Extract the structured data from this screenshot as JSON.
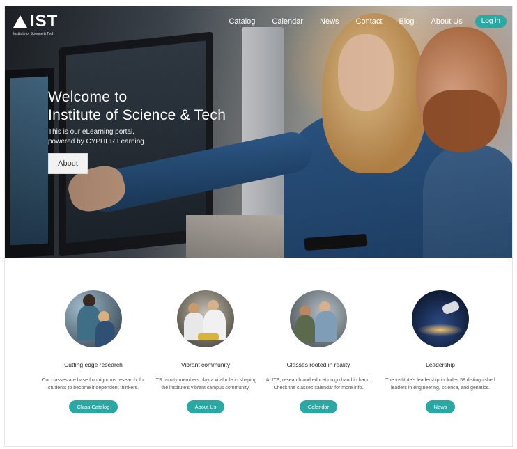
{
  "brand": {
    "logo": "IST",
    "tagline": "Institute of Science & Tech"
  },
  "nav": {
    "items": [
      "Catalog",
      "Calendar",
      "News",
      "Contact",
      "Blog",
      "About Us"
    ],
    "login": "Log in"
  },
  "hero": {
    "title_line1": "Welcome to",
    "title_line2": "Institute of Science & Tech",
    "subtitle_line1": "This is our eLearning portal,",
    "subtitle_line2": "powered by CYPHER Learning",
    "button": "About"
  },
  "features": [
    {
      "title": "Cutting edge research",
      "description": "Our classes are based on rigorous research, for students to become independent thinkers.",
      "button": "Class Catalog",
      "image": "research-photo"
    },
    {
      "title": "Vibrant community",
      "description": "ITS faculty members play a vital role in shaping the institute's vibrant campus community.",
      "button": "About Us",
      "image": "community-photo"
    },
    {
      "title": "Classes rooted in reality",
      "description": "At ITS, research and education go hand in hand. Check the classes calendar for more info.",
      "button": "Calendar",
      "image": "classes-photo"
    },
    {
      "title": "Leadership",
      "description": "The institute's leadership includes 58 distinguished leaders in engineering, science, and genetics.",
      "button": "News",
      "image": "leadership-photo"
    }
  ],
  "colors": {
    "accent": "#2ba8a3"
  }
}
